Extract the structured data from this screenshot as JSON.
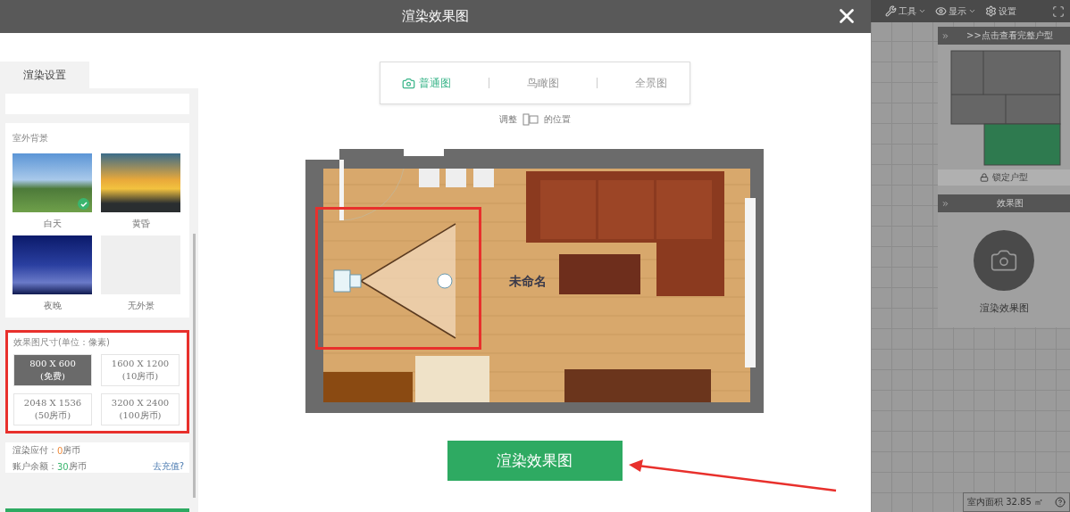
{
  "dialog": {
    "title": "渲染效果图"
  },
  "settings_panel": {
    "tab": "渲染设置",
    "background_section": {
      "title": "室外背景",
      "options": [
        {
          "label": "白天",
          "kind": "day",
          "selected": true
        },
        {
          "label": "黄昏",
          "kind": "dusk",
          "selected": false
        },
        {
          "label": "夜晚",
          "kind": "night",
          "selected": false
        },
        {
          "label": "无外景",
          "kind": "none",
          "selected": false
        }
      ]
    },
    "size_section": {
      "title": "效果图尺寸(单位：像素)",
      "options": [
        {
          "size": "800 X 600",
          "price": "(免费)",
          "selected": true
        },
        {
          "size": "1600 X 1200",
          "price": "(10房币)",
          "selected": false
        },
        {
          "size": "2048 X 1536",
          "price": "(50房币)",
          "selected": false
        },
        {
          "size": "3200 X 2400",
          "price": "(100房币)",
          "selected": false
        }
      ]
    },
    "cost": {
      "label": "渲染应付：",
      "amount": "0",
      "unit": "房币"
    },
    "balance": {
      "label": "账户余额：",
      "amount": "30",
      "unit": "房币"
    },
    "recharge_link": "去充值?"
  },
  "view_tabs": [
    {
      "label": "普通图",
      "selected": true
    },
    {
      "label": "鸟瞰图",
      "selected": false
    },
    {
      "label": "全景图",
      "selected": false
    }
  ],
  "camera_hint": {
    "before": "调整",
    "after": "的位置"
  },
  "plan": {
    "room_label": "未命名"
  },
  "render_button": "渲染效果图",
  "app": {
    "toolbar": [
      {
        "label": "工具",
        "kind": "tools"
      },
      {
        "label": "显示",
        "kind": "view"
      },
      {
        "label": "设置",
        "kind": "settings"
      }
    ],
    "plan_panel": {
      "header": ">>点击查看完整户型",
      "lock": "锁定户型"
    },
    "effects_panel": {
      "header": "效果图",
      "action": "渲染效果图"
    },
    "area": "室内面积 32.85 ㎡"
  }
}
